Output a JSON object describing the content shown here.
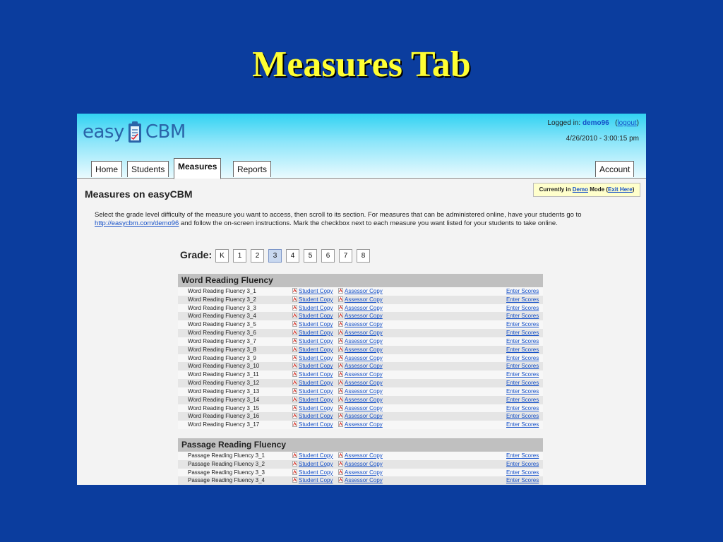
{
  "slide_title": "Measures Tab",
  "header": {
    "logo_left": "easy",
    "logo_right": "CBM",
    "logged_in_label": "Logged in:",
    "username": "demo96",
    "logout_label": "logout",
    "datetime": "4/26/2010 - 3:00:15 pm"
  },
  "tabs": [
    {
      "label": "Home"
    },
    {
      "label": "Students"
    },
    {
      "label": "Measures"
    },
    {
      "label": "Reports"
    },
    {
      "label": "Account"
    }
  ],
  "page": {
    "title": "Measures on easyCBM",
    "demo": {
      "prefix": "Currently in",
      "demo_link": "Demo",
      "middle": "Mode (",
      "exit_link": "Exit Here",
      "suffix": ")"
    },
    "instructions_part1": "Select the grade level difficulty of the measure you want to access, then scroll to its section. For measures that can be administered online, have your students go to",
    "instructions_link": "http://easycbm.com/demo96",
    "instructions_part2": "and follow the on-screen instructions. Mark the checkbox next to each measure you want listed for your students to take online."
  },
  "grade": {
    "label": "Grade:",
    "options": [
      "K",
      "1",
      "2",
      "3",
      "4",
      "5",
      "6",
      "7",
      "8"
    ],
    "selected": "3"
  },
  "links": {
    "student_copy": "Student Copy",
    "assessor_copy": "Assessor Copy",
    "enter_scores": "Enter Scores"
  },
  "sections": [
    {
      "title": "Word Reading Fluency",
      "items": [
        "Word Reading Fluency 3_1",
        "Word Reading Fluency 3_2",
        "Word Reading Fluency 3_3",
        "Word Reading Fluency 3_4",
        "Word Reading Fluency 3_5",
        "Word Reading Fluency 3_6",
        "Word Reading Fluency 3_7",
        "Word Reading Fluency 3_8",
        "Word Reading Fluency 3_9",
        "Word Reading Fluency 3_10",
        "Word Reading Fluency 3_11",
        "Word Reading Fluency 3_12",
        "Word Reading Fluency 3_13",
        "Word Reading Fluency 3_14",
        "Word Reading Fluency 3_15",
        "Word Reading Fluency 3_16",
        "Word Reading Fluency 3_17"
      ]
    },
    {
      "title": "Passage Reading Fluency",
      "items": [
        "Passage Reading Fluency 3_1",
        "Passage Reading Fluency 3_2",
        "Passage Reading Fluency 3_3",
        "Passage Reading Fluency 3_4"
      ]
    }
  ],
  "colors": {
    "slide_bg": "#0b3d9e",
    "title": "#ffff33",
    "link": "#1550c8",
    "section_header": "#c0c0c0"
  }
}
